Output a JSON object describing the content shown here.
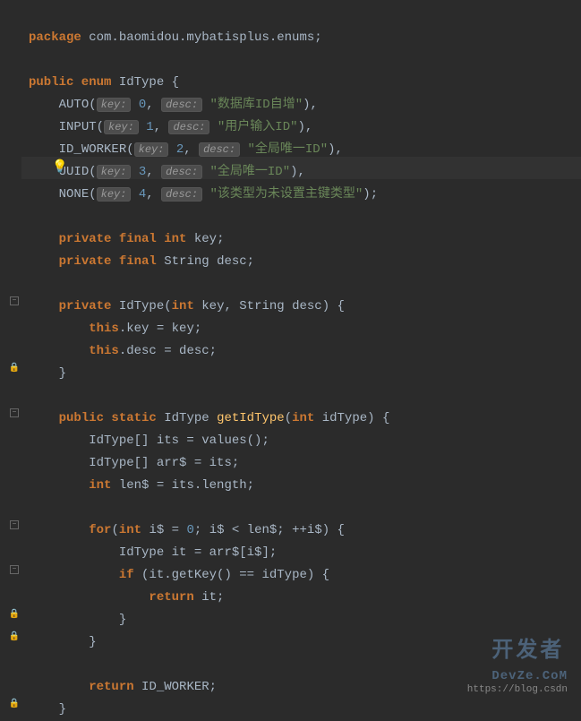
{
  "package": {
    "keyword": "package",
    "name": "com.baomidou.mybatisplus.enums;"
  },
  "enum_decl": {
    "modifiers": "public enum",
    "name": "IdType",
    "open": "{"
  },
  "enum_constants": [
    {
      "name": "AUTO",
      "key_hint": "key:",
      "key": "0",
      "desc_hint": "desc:",
      "desc": "\"数据库ID自增\"",
      "end": "),"
    },
    {
      "name": "INPUT",
      "key_hint": "key:",
      "key": "1",
      "desc_hint": "desc:",
      "desc": "\"用户输入ID\"",
      "end": "),"
    },
    {
      "name": "ID_WORKER",
      "key_hint": "key:",
      "key": "2",
      "desc_hint": "desc:",
      "desc": "\"全局唯一ID\"",
      "end": "),"
    },
    {
      "name": "UUID",
      "key_hint": "key:",
      "key": "3",
      "desc_hint": "desc:",
      "desc": "\"全局唯一ID\"",
      "end": "),"
    },
    {
      "name": "NONE",
      "key_hint": "key:",
      "key": "4",
      "desc_hint": "desc:",
      "desc": "\"该类型为未设置主键类型\"",
      "end": ");"
    }
  ],
  "fields": [
    {
      "modifiers": "private final",
      "type": "int",
      "name": "key;"
    },
    {
      "modifiers": "private final",
      "type": "String",
      "name": "desc;"
    }
  ],
  "constructor": {
    "modifier": "private",
    "name": "IdType",
    "params": "int key, String desc",
    "int_kw": "int",
    "body": [
      {
        "this_kw": "this",
        "rest": ".key = key;"
      },
      {
        "this_kw": "this",
        "rest": ".desc = desc;"
      }
    ]
  },
  "method": {
    "modifiers": "public static",
    "return_type": "IdType",
    "name": "getIdType",
    "param_int": "int",
    "param_name": "idType",
    "lines": {
      "l1": "IdType[] its = values();",
      "l2": "IdType[] arr$ = its;",
      "l3_int": "int",
      "l3_rest": " len$ = its.length;",
      "for_kw": "for",
      "for_int": "int",
      "for_init": " i$ = ",
      "for_zero": "0",
      "for_cond": "; i$ < len$; ++i$) {",
      "l5": "IdType it = arr$[i$];",
      "if_kw": "if",
      "if_cond": " (it.getKey() == idType) {",
      "return_kw": "return",
      "return_val": " it;",
      "return2_kw": "return",
      "return2_val": " ID_WORKER;"
    }
  },
  "watermark": {
    "logo": "开发者",
    "logo_en": "DevZe.CoM",
    "url": "https://blog.csdn"
  }
}
